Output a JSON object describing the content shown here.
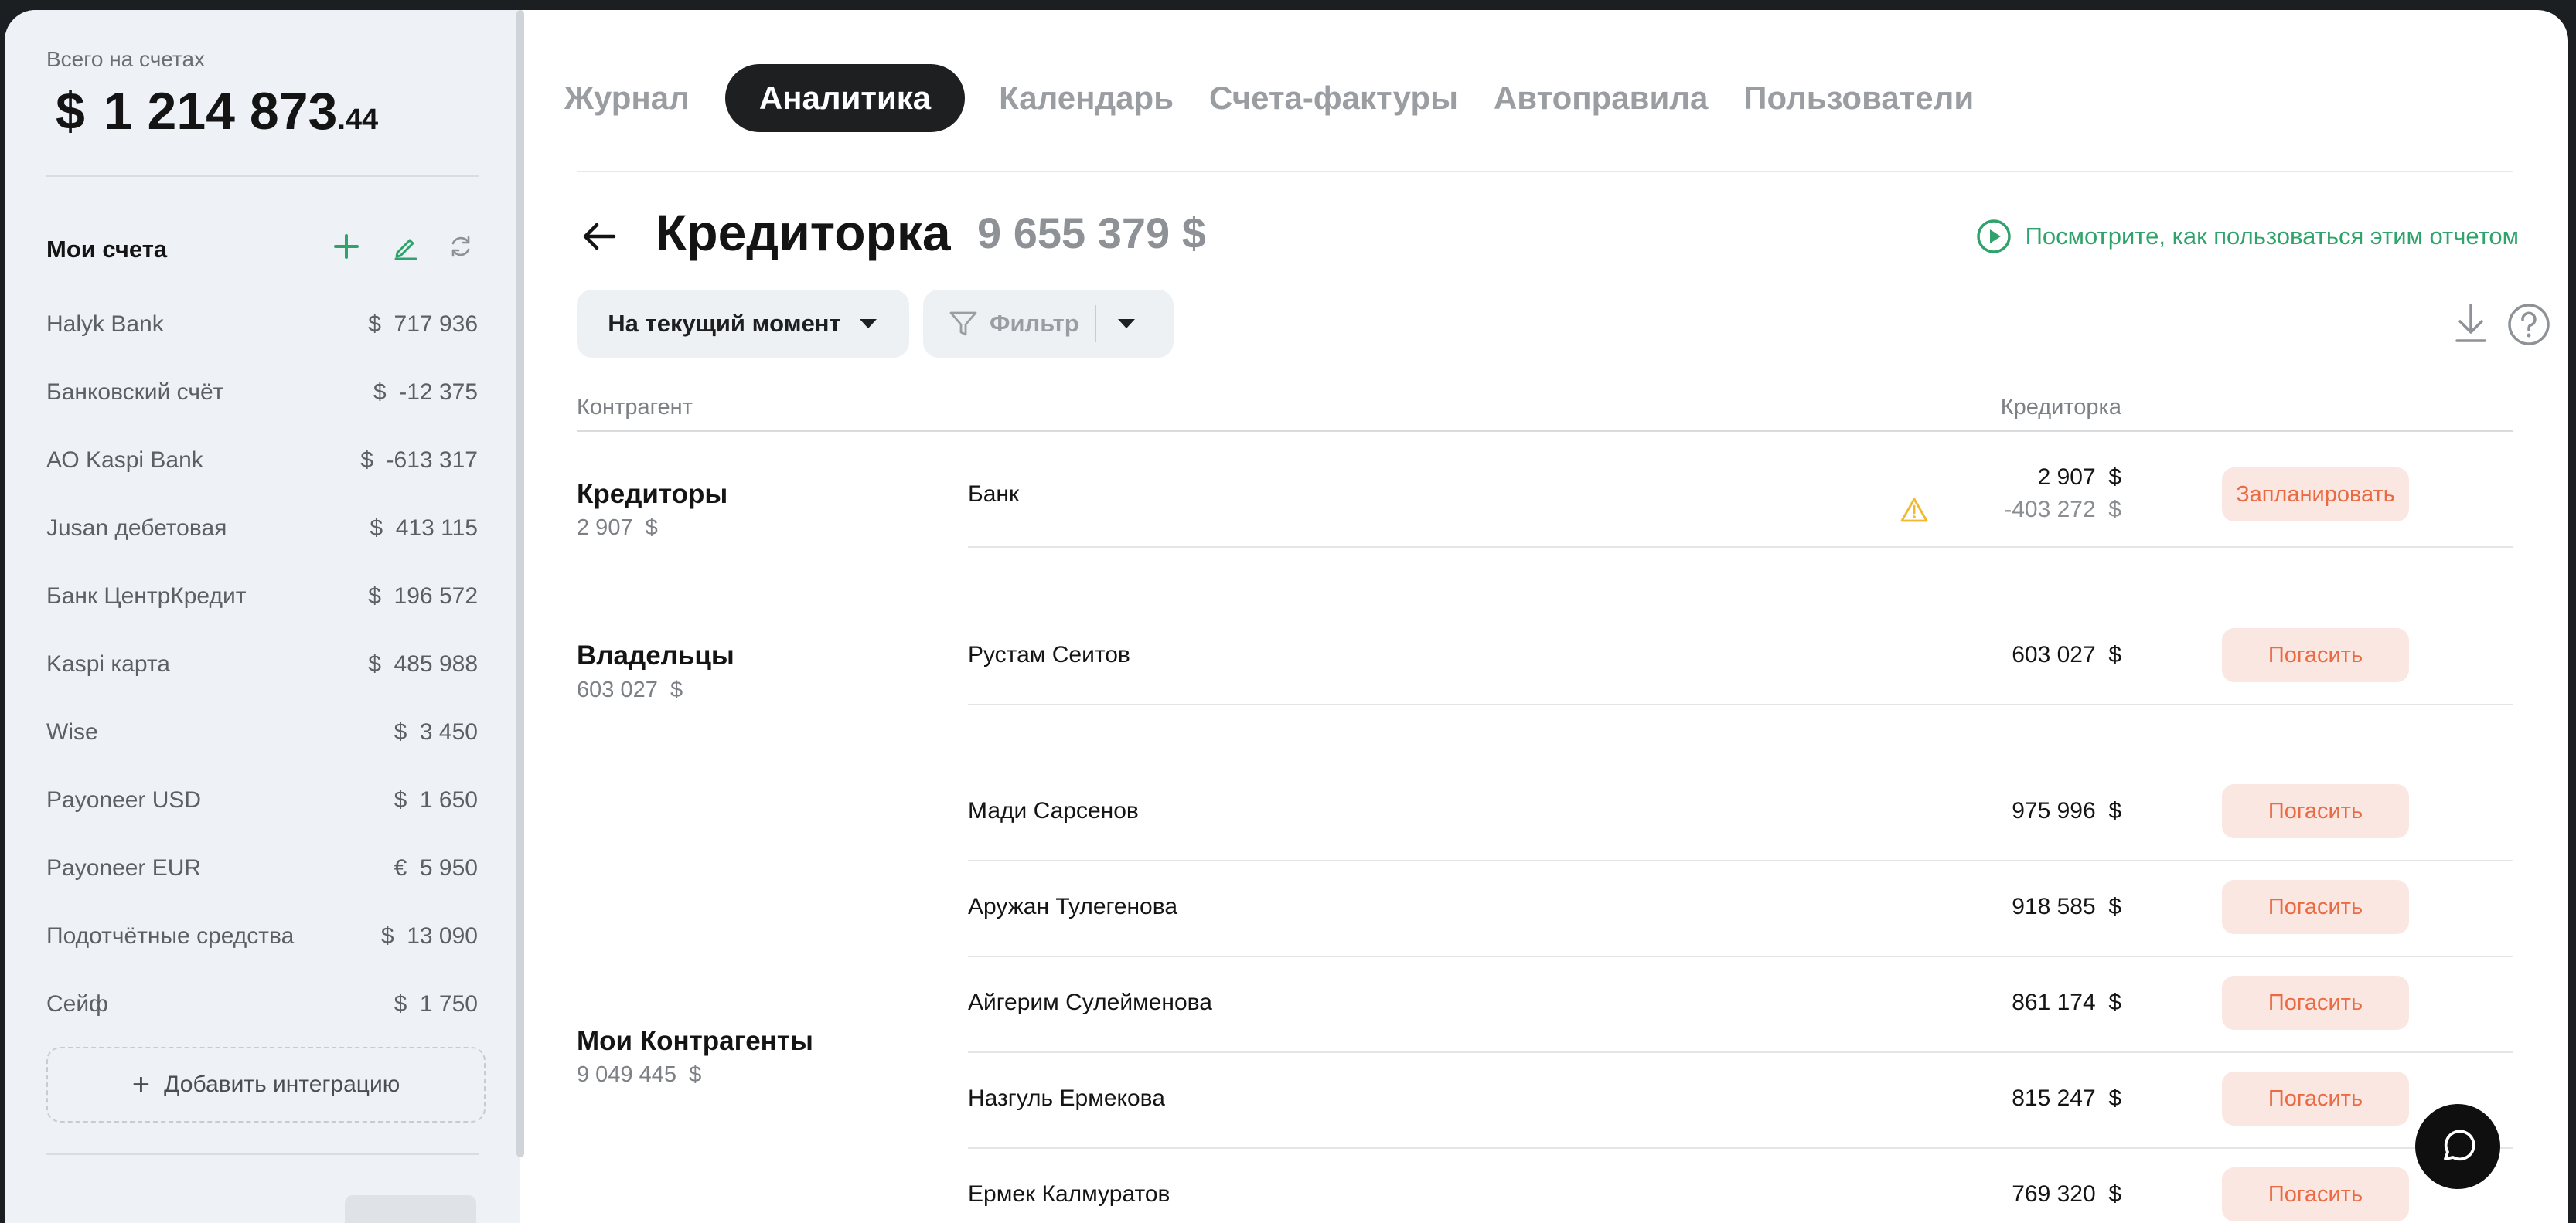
{
  "sidebar": {
    "total_label": "Всего на счетах",
    "total_currency": "$",
    "total_main": "1 214 873",
    "total_cents": ".44",
    "my_accounts_title": "Мои счета",
    "accounts": [
      {
        "name": "Halyk Bank",
        "amount": "$  717 936"
      },
      {
        "name": "Банковский счёт",
        "amount": "$  -12 375"
      },
      {
        "name": "АО Kaspi Bank",
        "amount": "$  -613 317"
      },
      {
        "name": "Jusan дебетовая",
        "amount": "$  413 115"
      },
      {
        "name": "Банк ЦентрКредит",
        "amount": "$  196 572"
      },
      {
        "name": "Kaspi карта",
        "amount": "$  485 988"
      },
      {
        "name": "Wise",
        "amount": "$  3 450"
      },
      {
        "name": "Payoneer USD",
        "amount": "$  1 650"
      },
      {
        "name": "Payoneer EUR",
        "amount": "€  5 950"
      },
      {
        "name": "Подотчётные средства",
        "amount": "$  13 090"
      },
      {
        "name": "Сейф",
        "amount": "$  1 750"
      }
    ],
    "add_integration_label": "Добавить интеграцию",
    "icons": {
      "add": "plus-icon",
      "edit": "pencil-icon",
      "refresh": "refresh-icon"
    }
  },
  "tabs": [
    {
      "label": "Журнал",
      "active": false
    },
    {
      "label": "Аналитика",
      "active": true
    },
    {
      "label": "Календарь",
      "active": false
    },
    {
      "label": "Счета-фактуры",
      "active": false
    },
    {
      "label": "Автоправила",
      "active": false
    },
    {
      "label": "Пользователи",
      "active": false
    }
  ],
  "report": {
    "title": "Кредиторка",
    "total": "9 655 379  $",
    "howto_link": "Посмотрите, как пользоваться этим отчетом",
    "period_button": "На текущий момент",
    "filter_button": "Фильтр",
    "col_counterparty": "Контрагент",
    "col_amount": "Кредиторка"
  },
  "groups": [
    {
      "title": "Кредиторы",
      "sum": "2 907  $",
      "rows": [
        {
          "name": "Банк",
          "amount": "2 907  $",
          "sub_amount": "-403 272  $",
          "warning": true,
          "action": "Запланировать"
        }
      ]
    },
    {
      "title": "Владельцы",
      "sum": "603 027  $",
      "rows": [
        {
          "name": "Рустам Сеитов",
          "amount": "603 027  $",
          "action": "Погасить"
        }
      ]
    },
    {
      "title": "Мои Контрагенты",
      "sum": "9 049 445  $",
      "rows": [
        {
          "name": "Мади Сарсенов",
          "amount": "975 996  $",
          "action": "Погасить"
        },
        {
          "name": "Аружан Тулегенова",
          "amount": "918 585  $",
          "action": "Погасить"
        },
        {
          "name": "Айгерим Сулейменова",
          "amount": "861 174  $",
          "action": "Погасить"
        },
        {
          "name": "Назгуль Ермекова",
          "amount": "815 247  $",
          "action": "Погасить"
        },
        {
          "name": "Ермек Калмуратов",
          "amount": "769 320  $",
          "action": "Погасить"
        }
      ]
    }
  ],
  "colors": {
    "accent_green": "#2fa36b",
    "action_text": "#ea6a44",
    "action_bg": "#fbe7e1",
    "warning": "#f2b930"
  }
}
